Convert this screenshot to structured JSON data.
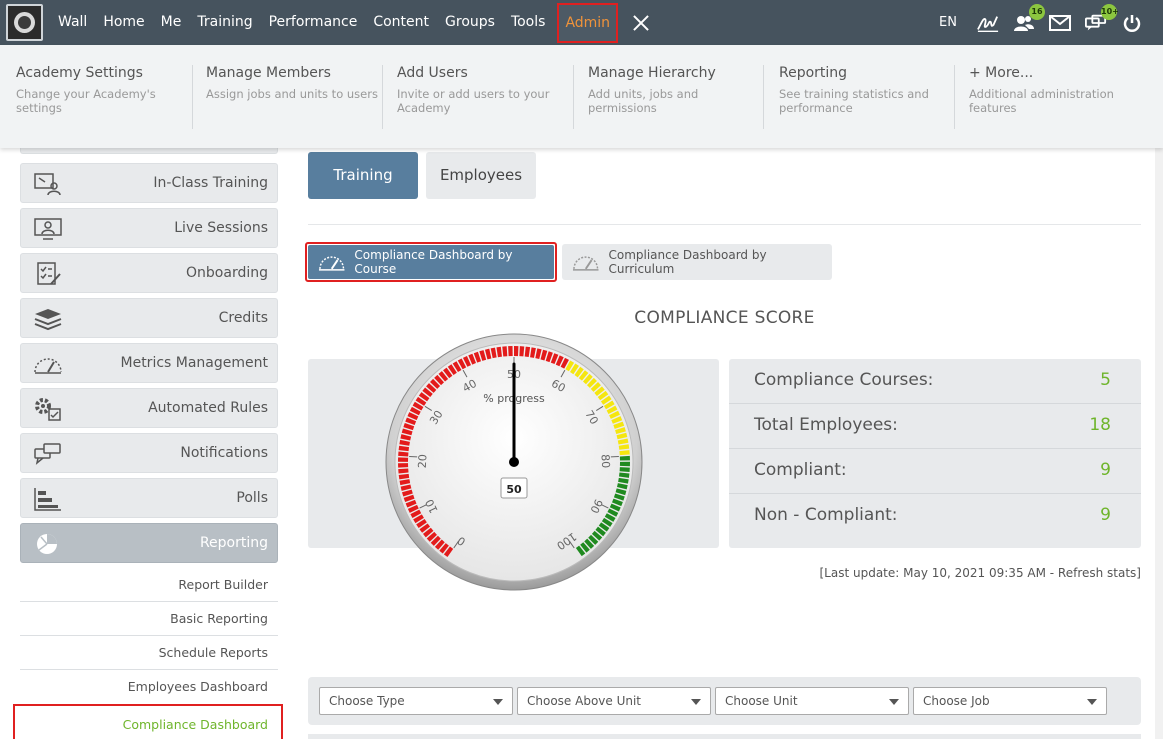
{
  "nav": {
    "items": [
      "Wall",
      "Home",
      "Me",
      "Training",
      "Performance",
      "Content",
      "Groups",
      "Tools"
    ],
    "admin_label": "Admin",
    "lang": "EN",
    "badges": {
      "users": "16",
      "chat": "10+"
    }
  },
  "admin_menu": [
    {
      "title": "Academy Settings",
      "desc": "Change your Academy's settings"
    },
    {
      "title": "Manage Members",
      "desc": "Assign jobs and units to users"
    },
    {
      "title": "Add Users",
      "desc": "Invite or add users to your Academy"
    },
    {
      "title": "Manage Hierarchy",
      "desc": "Add units, jobs and permissions"
    },
    {
      "title": "Reporting",
      "desc": "See training statistics and performance"
    },
    {
      "title": "+ More...",
      "desc": "Additional administration features"
    }
  ],
  "sidebar": {
    "items": [
      {
        "label": "In-Class Training",
        "icon": "classroom-icon"
      },
      {
        "label": "Live Sessions",
        "icon": "monitor-icon"
      },
      {
        "label": "Onboarding",
        "icon": "checklist-icon"
      },
      {
        "label": "Credits",
        "icon": "layers-icon"
      },
      {
        "label": "Metrics Management",
        "icon": "speedometer-icon"
      },
      {
        "label": "Automated Rules",
        "icon": "gear-rules-icon"
      },
      {
        "label": "Notifications",
        "icon": "chat-bubbles-icon"
      },
      {
        "label": "Polls",
        "icon": "bar-chart-icon"
      },
      {
        "label": "Reporting",
        "icon": "pie-chart-icon"
      }
    ],
    "subitems": [
      "Report Builder",
      "Basic Reporting",
      "Schedule Reports",
      "Employees Dashboard",
      "Compliance Dashboard"
    ]
  },
  "main": {
    "tabs": [
      "Training",
      "Employees"
    ],
    "dashboard_buttons": [
      "Compliance Dashboard by Course",
      "Compliance Dashboard by Curriculum"
    ],
    "score_title": "COMPLIANCE SCORE",
    "gauge": {
      "label": "% progress",
      "value": 50,
      "value_text": "50",
      "ticks": [
        "0",
        "10",
        "20",
        "30",
        "40",
        "50",
        "60",
        "70",
        "80",
        "90",
        "100"
      ]
    },
    "stats": [
      {
        "label": "Compliance Courses:",
        "value": "5"
      },
      {
        "label": "Total Employees:",
        "value": "18"
      },
      {
        "label": "Compliant:",
        "value": "9"
      },
      {
        "label": "Non - Compliant:",
        "value": "9"
      }
    ],
    "last_update": "[Last update: May 10, 2021 09:35 AM - Refresh stats]",
    "filters": [
      "Choose Type",
      "Choose Above Unit",
      "Choose Unit",
      "Choose Job"
    ]
  },
  "colors": {
    "topbar": "#46535e",
    "accent_blue": "#587e9e",
    "green": "#6fb52c",
    "admin_orange": "#f0933a",
    "highlight_red": "#e02020"
  }
}
